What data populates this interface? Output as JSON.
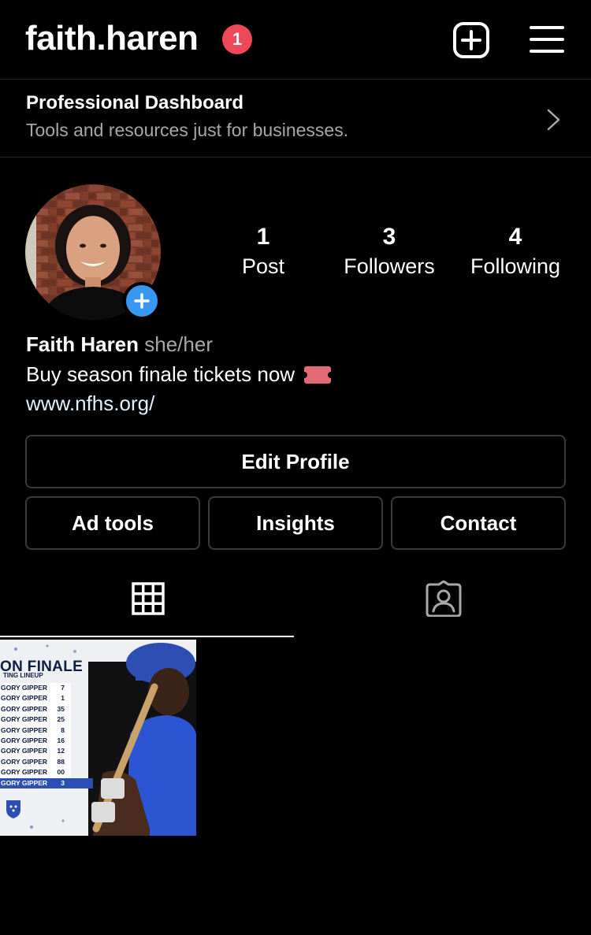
{
  "header": {
    "username": "faith.haren",
    "notification_count": "1",
    "new_post_icon": "plus-square-icon",
    "menu_icon": "hamburger-menu-icon"
  },
  "dashboard": {
    "title": "Professional Dashboard",
    "subtitle": "Tools and resources just for businesses.",
    "icon": "chevron-right-icon"
  },
  "profile": {
    "stats": [
      {
        "value": "1",
        "label": "Post"
      },
      {
        "value": "3",
        "label": "Followers"
      },
      {
        "value": "4",
        "label": "Following"
      }
    ],
    "name": "Faith Haren",
    "pronouns": "she/her",
    "bio": "Buy season finale tickets now",
    "bio_emoji": "ticket-emoji",
    "link": "www.nfhs.org/"
  },
  "buttons": {
    "edit_profile": "Edit Profile",
    "ad_tools": "Ad tools",
    "insights": "Insights",
    "contact": "Contact"
  },
  "tabs": {
    "grid_icon": "grid-icon",
    "tagged_icon": "tagged-person-icon",
    "active": "grid"
  },
  "post": {
    "heading": "ON FINALE",
    "subheading": "TING LINEUP",
    "lineup": [
      {
        "name": "GORY GIPPER",
        "number": "7"
      },
      {
        "name": "GORY GIPPER",
        "number": "1"
      },
      {
        "name": "GORY GIPPER",
        "number": "35"
      },
      {
        "name": "GORY GIPPER",
        "number": "25"
      },
      {
        "name": "GORY GIPPER",
        "number": "8"
      },
      {
        "name": "GORY GIPPER",
        "number": "16"
      },
      {
        "name": "GORY GIPPER",
        "number": "12"
      },
      {
        "name": "GORY GIPPER",
        "number": "88"
      },
      {
        "name": "GORY GIPPER",
        "number": "00"
      },
      {
        "name": "GORY GIPPER",
        "number": "3"
      }
    ]
  },
  "colors": {
    "background": "#000000",
    "badge": "#ed4956",
    "accent_blue": "#3897f0",
    "muted_text": "#a8a8a8",
    "border": "#3a3a3a"
  }
}
